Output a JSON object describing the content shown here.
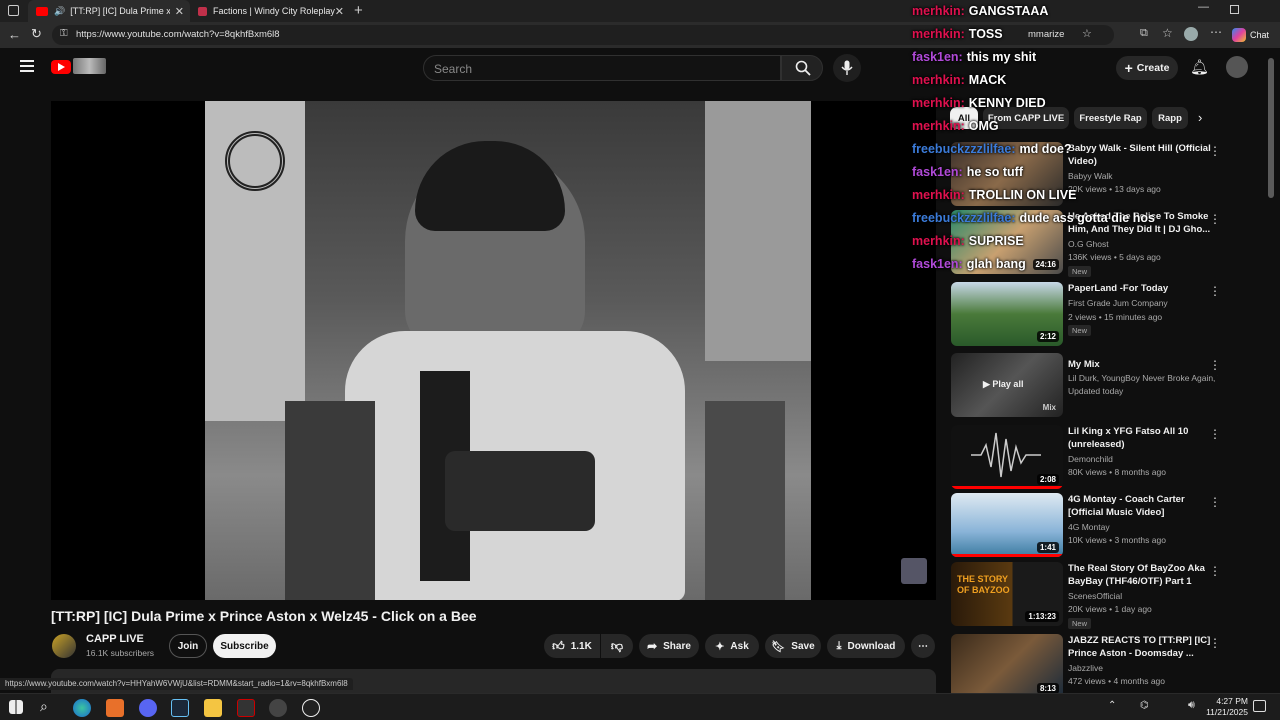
{
  "browser": {
    "tabs": [
      {
        "label": "[TT:RP] [IC] Dula Prime x Prin",
        "active": true
      },
      {
        "label": "Factions | Windy City Roleplay",
        "active": false
      }
    ],
    "url": "https://www.youtube.com/watch?v=8qkhfBxm6l8",
    "chat_button": "Chat",
    "summarize_fragment": "mmarize"
  },
  "youtube": {
    "search_placeholder": "Search",
    "create_label": "Create",
    "video": {
      "title": "[TT:RP] [IC] Dula Prime x Prince Aston x Welz45 - Click on a Bee",
      "channel": "CAPP LIVE",
      "subscribers": "16.1K subscribers",
      "join_label": "Join",
      "subscribe_label": "Subscribe",
      "likes": "1.1K",
      "share_label": "Share",
      "ask_label": "Ask",
      "save_label": "Save",
      "download_label": "Download"
    },
    "chips": [
      "All",
      "From CAPP LIVE",
      "Freestyle Rap",
      "Rapp"
    ],
    "recommendations": [
      {
        "title": "Babyy Walk - Silent Hill (Official Video)",
        "channel": "Babyy Walk",
        "meta": "20K views • 13 days ago",
        "duration": "",
        "badge": ""
      },
      {
        "title": "He Asked The Police To Smoke Him, And They Did It | DJ Gho...",
        "channel": "O.G Ghost",
        "meta": "136K views • 5 days ago",
        "duration": "24:16",
        "badge": "New"
      },
      {
        "title": "PaperLand -For Today",
        "channel": "First Grade Jum Company",
        "meta": "2 views • 15 minutes ago",
        "duration": "2:12",
        "badge": "New"
      },
      {
        "title": "My Mix",
        "channel": "Lil Durk, YoungBoy Never Broke Again, Y...",
        "meta": "Updated today",
        "duration": "Mix",
        "badge": "",
        "overlay": "Play all"
      },
      {
        "title": "Lil King x YFG Fatso All 10 (unreleased)",
        "channel": "Demonchild",
        "meta": "80K views • 8 months ago",
        "duration": "2:08",
        "badge": ""
      },
      {
        "title": "4G Montay - Coach Carter [Official Music Video]",
        "channel": "4G Montay",
        "meta": "10K views • 3 months ago",
        "duration": "1:41",
        "badge": ""
      },
      {
        "title": "The Real Story Of BayZoo Aka BayBay (THF46/OTF) Part 1",
        "channel": "ScenesOfficial",
        "meta": "20K views • 1 day ago",
        "duration": "1:13:23",
        "badge": "New",
        "thumb_text": "THE STORY OF BAYZOO"
      },
      {
        "title": "JABZZ REACTS TO [TT:RP] [IC] Prince Aston - Doomsday ...",
        "channel": "Jabzzlive",
        "meta": "472 views • 4 months ago",
        "duration": "8:13",
        "badge": ""
      }
    ]
  },
  "chat_overlay": [
    {
      "user": "merhkin:",
      "message": "GANGSTAAA",
      "color": "#e0114f"
    },
    {
      "user": "merhkin:",
      "message": "TOSS",
      "color": "#e0114f"
    },
    {
      "user": "fask1en:",
      "message": "this my shit",
      "color": "#b04ad8"
    },
    {
      "user": "merhkin:",
      "message": "MACK",
      "color": "#e0114f"
    },
    {
      "user": "merhkin:",
      "message": "KENNY DIED",
      "color": "#e0114f"
    },
    {
      "user": "merhkin:",
      "message": "OMG",
      "color": "#e0114f"
    },
    {
      "user": "freebuckzzzlilfae:",
      "message": "md doe?",
      "color": "#3b7bd9"
    },
    {
      "user": "fask1en:",
      "message": "he so tuff",
      "color": "#b04ad8"
    },
    {
      "user": "merhkin:",
      "message": "TROLLIN ON LIVE",
      "color": "#e0114f"
    },
    {
      "user": "freebuckzzzlilfae:",
      "message": "dude ass gotta die hos",
      "color": "#3b7bd9"
    },
    {
      "user": "merhkin:",
      "message": "SUPRISE",
      "color": "#e0114f"
    },
    {
      "user": "fask1en:",
      "message": "glah bang",
      "color": "#b04ad8"
    }
  ],
  "status_url": "https://www.youtube.com/watch?v=HHYahW6VWjU&list=RDMM&start_radio=1&rv=8qkhfBxm6l8",
  "taskbar": {
    "time": "4:27 PM",
    "date": "11/21/2025"
  },
  "colors": {
    "youtube_red": "#ff0000",
    "bg": "#0f0f0f"
  }
}
